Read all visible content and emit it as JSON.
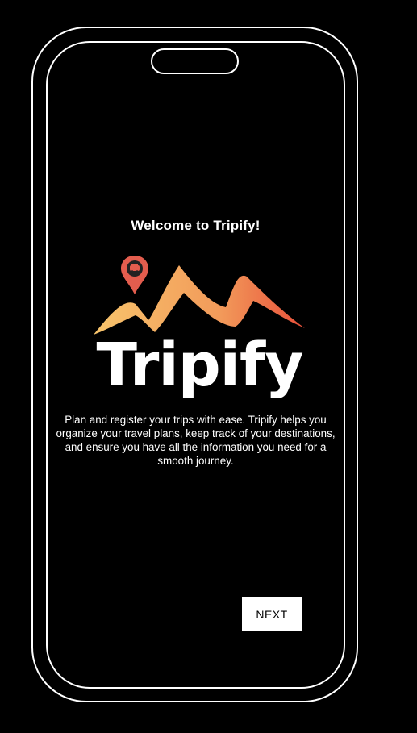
{
  "screen": {
    "welcome_title": "Welcome to Tripify!",
    "logo": {
      "text": "Tripify",
      "pin_icon": "car-location-pin-icon",
      "colors": {
        "gradient_start": "#f7c46c",
        "gradient_end": "#e8503a",
        "pin": "#e35d4e",
        "text": "#ffffff"
      }
    },
    "description": "Plan and register your trips with ease. Tripify helps you organize your travel plans, keep track of your destinations, and ensure you have all the information you need for a smooth journey.",
    "next_button_label": "NEXT"
  },
  "colors": {
    "background": "#000000",
    "frame": "#ffffff",
    "button_bg": "#ffffff",
    "button_text": "#000000"
  }
}
